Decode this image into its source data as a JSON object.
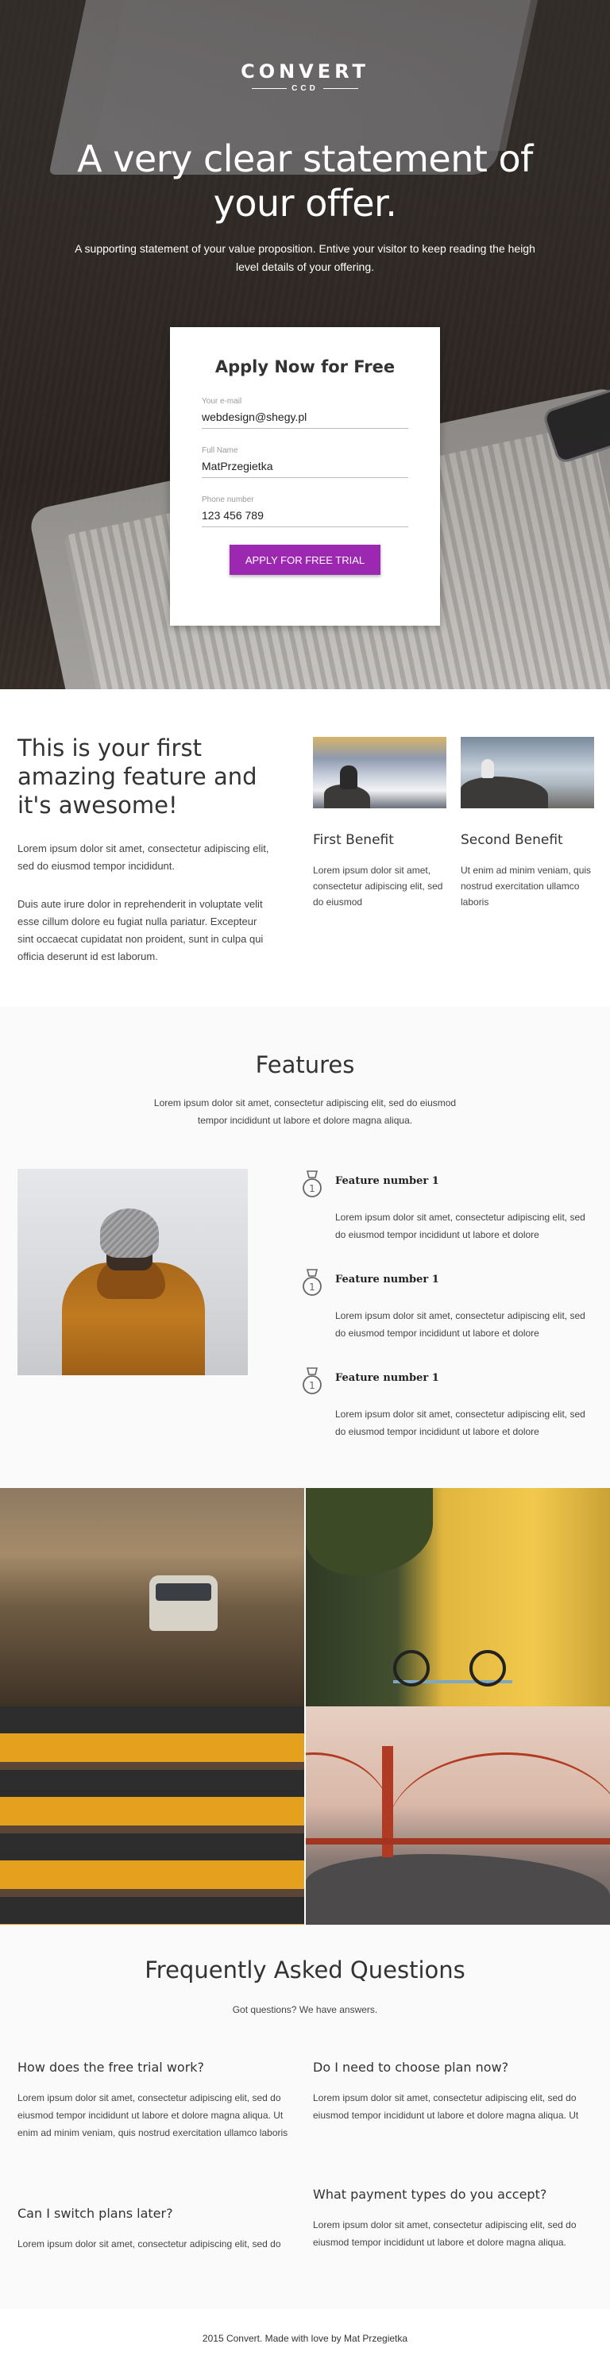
{
  "brand": {
    "logo_main": "CONVERT",
    "logo_sub": "CCD"
  },
  "hero": {
    "title": "A very clear statement of your offer.",
    "subtitle": "A supporting statement of your value proposition. Entive your visitor to keep reading the heigh level details of your offering."
  },
  "form": {
    "title": "Apply Now for Free",
    "fields": [
      {
        "label": "Your e-mail",
        "value": "webdesign@shegy.pl"
      },
      {
        "label": "Full Name",
        "value": "MatPrzegietka"
      },
      {
        "label": "Phone number",
        "value": "123 456 789"
      }
    ],
    "cta_label": "APPLY FOR FREE TRIAL",
    "cta_color": "#9c27b0"
  },
  "intro": {
    "title": "This is your first amazing feature and it's awesome!",
    "paragraphs": [
      "Lorem ipsum dolor sit amet, consectetur adipiscing elit, sed do eiusmod tempor incididunt.",
      "Duis aute irure dolor in reprehenderit in voluptate velit esse cillum dolore eu fugiat nulla pariatur. Excepteur sint occaecat cupidatat non proident, sunt in culpa qui officia deserunt id est laborum."
    ],
    "benefits": [
      {
        "title": "First Benefit",
        "text": "Lorem ipsum dolor sit amet, consectetur adipiscing elit, sed do eiusmod"
      },
      {
        "title": "Second Benefit",
        "text": "Ut enim ad minim veniam, quis nostrud exercitation ullamco laboris"
      }
    ]
  },
  "features": {
    "title": "Features",
    "lead": "Lorem ipsum dolor sit amet, consectetur adipiscing elit, sed do eiusmod tempor incididunt ut labore et dolore magna aliqua.",
    "items": [
      {
        "icon": "medal-icon",
        "name": "Feature number 1",
        "text": "Lorem ipsum dolor sit amet, consectetur adipiscing elit, sed do eiusmod tempor incididunt ut labore et dolore"
      },
      {
        "icon": "medal-icon",
        "name": "Feature number 1",
        "text": "Lorem ipsum dolor sit amet, consectetur adipiscing elit, sed do eiusmod tempor incididunt ut labore et dolore"
      },
      {
        "icon": "medal-icon",
        "name": "Feature number 1",
        "text": "Lorem ipsum dolor sit amet, consectetur adipiscing elit, sed do eiusmod tempor incididunt ut labore et dolore"
      }
    ]
  },
  "faq": {
    "title": "Frequently Asked Questions",
    "lead": "Got questions? We have answers.",
    "items": [
      {
        "q": "How does the free trial work?",
        "a": "Lorem ipsum dolor sit amet, consectetur adipiscing elit, sed do eiusmod tempor incididunt ut labore et dolore magna aliqua. Ut enim ad minim veniam, quis nostrud exercitation ullamco laboris"
      },
      {
        "q": "Do I need to choose plan now?",
        "a": "Lorem ipsum dolor sit amet, consectetur adipiscing elit, sed do eiusmod tempor incididunt ut labore et dolore magna aliqua. Ut"
      },
      {
        "q": "Can I switch plans later?",
        "a": "Lorem ipsum dolor sit amet, consectetur adipiscing elit, sed do"
      },
      {
        "q": "What payment types do you accept?",
        "a": "Lorem ipsum dolor sit amet, consectetur adipiscing elit, sed do eiusmod tempor incididunt ut labore et dolore magna aliqua."
      }
    ]
  },
  "footer": {
    "text": "2015 Convert. Made with love by Mat Przegietka"
  }
}
